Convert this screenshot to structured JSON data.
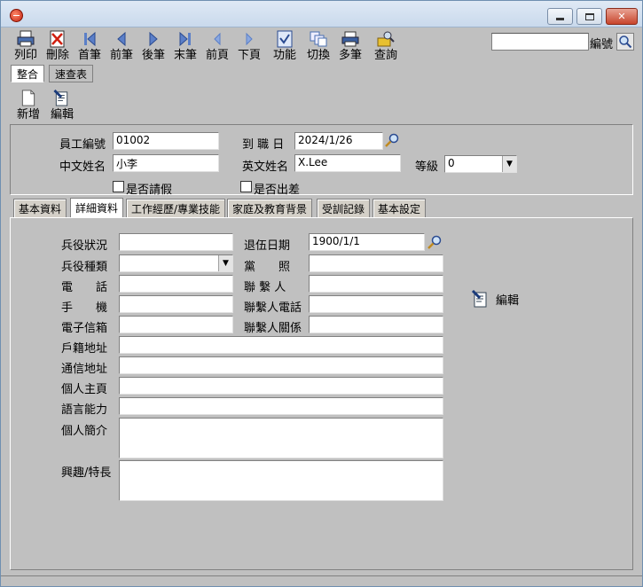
{
  "toolbar": {
    "items": [
      {
        "label": "列印",
        "icon": "printer-icon"
      },
      {
        "label": "刪除",
        "icon": "delete-icon"
      },
      {
        "label": "首筆",
        "icon": "first-record-icon"
      },
      {
        "label": "前筆",
        "icon": "previous-record-icon"
      },
      {
        "label": "後筆",
        "icon": "next-record-icon"
      },
      {
        "label": "末筆",
        "icon": "last-record-icon"
      },
      {
        "label": "前頁",
        "icon": "previous-page-icon"
      },
      {
        "label": "下頁",
        "icon": "next-page-icon"
      },
      {
        "label": "功能",
        "icon": "function-icon"
      },
      {
        "label": "切換",
        "icon": "switch-icon"
      },
      {
        "label": "多筆",
        "icon": "multi-record-icon"
      },
      {
        "label": "查詢",
        "icon": "query-icon"
      }
    ],
    "search_label": "編號",
    "search_value": ""
  },
  "top_tabs": [
    "整合",
    "速查表"
  ],
  "secondary_toolbar": {
    "new_label": "新增",
    "edit_label": "編輯"
  },
  "header": {
    "emp_id_label": "員工編號",
    "emp_id_value": "01002",
    "hire_date_label": "到 職 日",
    "hire_date_value": "2024/1/26",
    "cn_name_label": "中文姓名",
    "cn_name_value": "小李",
    "en_name_label": "英文姓名",
    "en_name_value": "X.Lee",
    "grade_label": "等級",
    "grade_value": "0",
    "leave_label": "是否請假",
    "business_trip_label": "是否出差"
  },
  "detail_tabs": [
    "基本資料",
    "詳細資料",
    "工作經歷/專業技能",
    "家庭及教育背景",
    "受訓記錄",
    "基本設定"
  ],
  "details": {
    "military_status_label": "兵役狀況",
    "military_type_label": "兵役種類",
    "phone_label": "電　　話",
    "mobile_label": "手　　機",
    "email_label": "電子信箱",
    "household_address_label": "戶籍地址",
    "mailing_address_label": "通信地址",
    "homepage_label": "個人主頁",
    "language_label": "語言能力",
    "bio_label": "個人簡介",
    "hobbies_label": "興趣/特長",
    "discharge_date_label": "退伍日期",
    "discharge_date_value": "1900/1/1",
    "party_label": "黨　　照",
    "contact_label": "聯 繫 人",
    "contact_phone_label": "聯繫人電話",
    "contact_relation_label": "聯繫人關係",
    "edit_label": "編輯"
  }
}
